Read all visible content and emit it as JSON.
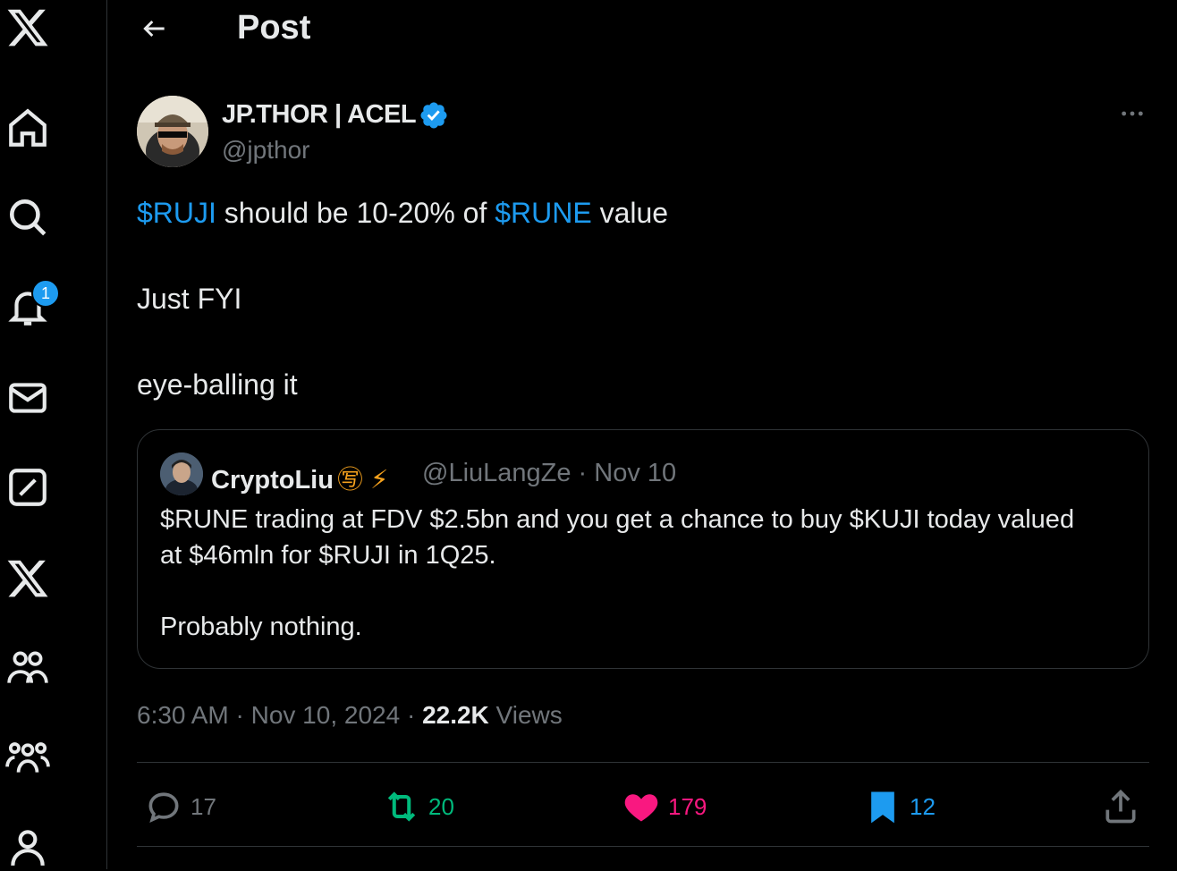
{
  "colors": {
    "background": "#000000",
    "text": "#e7e9ea",
    "muted": "#71767b",
    "accent": "#1d9bf0",
    "retweet": "#00ba7c",
    "like": "#f91880"
  },
  "sidebar": {
    "items": [
      {
        "icon": "x-logo-icon"
      },
      {
        "icon": "home-icon"
      },
      {
        "icon": "search-icon"
      },
      {
        "icon": "bell-icon",
        "badge": "1"
      },
      {
        "icon": "mail-icon"
      },
      {
        "icon": "grok-icon"
      },
      {
        "icon": "x-premium-icon"
      },
      {
        "icon": "communities-icon"
      },
      {
        "icon": "groups-icon"
      },
      {
        "icon": "profile-icon"
      }
    ]
  },
  "header": {
    "title": "Post"
  },
  "post": {
    "author_name": "JP.THOR | ACEL",
    "author_handle": "@jpthor",
    "line1_tag1": "$RUJI",
    "line1_mid": " should be 10-20% of ",
    "line1_tag2": "$RUNE",
    "line1_end": " value",
    "line2": "Just FYI",
    "line3": "eye-balling it",
    "timestamp": "6:30 AM · Nov 10, 2024 · ",
    "views_count": "22.2K",
    "views_label": " Views"
  },
  "quote": {
    "author_name": "CryptoLiu",
    "author_emoji": "㊢ ⚡",
    "author_handle": "@LiuLangZe · Nov 10",
    "line1": "$RUNE trading at FDV $2.5bn and you get a chance to buy $KUJI today valued",
    "line2": "at $46mln for $RUJI in 1Q25.",
    "line3": "Probably nothing."
  },
  "actions": {
    "replies": "17",
    "reposts": "20",
    "likes": "179",
    "bookmarks": "12"
  }
}
